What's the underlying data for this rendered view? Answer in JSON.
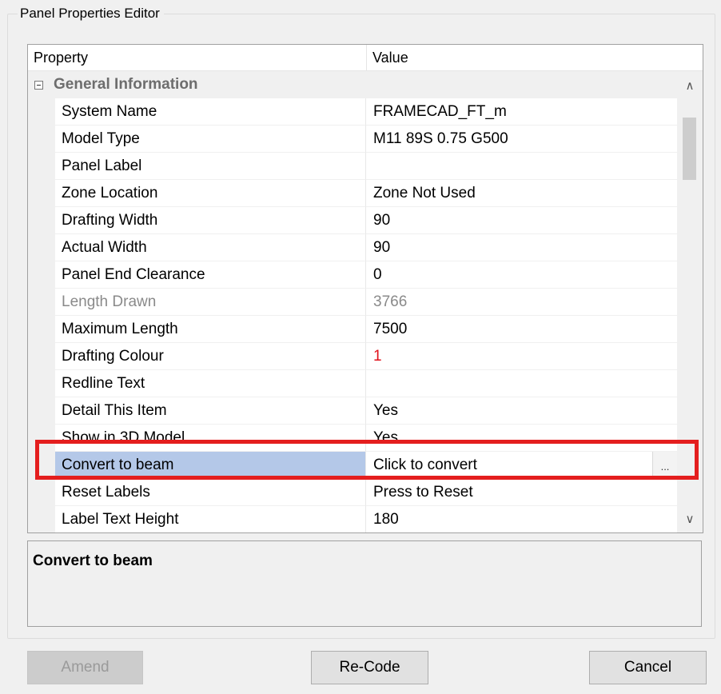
{
  "dialog": {
    "title": "Panel Properties Editor"
  },
  "grid": {
    "columns": {
      "property": "Property",
      "value": "Value"
    },
    "category": "General Information",
    "rows": [
      {
        "property": "System Name",
        "value": "FRAMECAD_FT_m"
      },
      {
        "property": "Model Type",
        "value": "M11 89S 0.75 G500"
      },
      {
        "property": "Panel Label",
        "value": ""
      },
      {
        "property": "Zone Location",
        "value": "Zone Not Used"
      },
      {
        "property": "Drafting Width",
        "value": "90"
      },
      {
        "property": "Actual Width",
        "value": "90"
      },
      {
        "property": "Panel End Clearance",
        "value": "0"
      },
      {
        "property": "Length Drawn",
        "value": "3766"
      },
      {
        "property": "Maximum Length",
        "value": "7500"
      },
      {
        "property": "Drafting Colour",
        "value": "1"
      },
      {
        "property": "Redline Text",
        "value": ""
      },
      {
        "property": "Detail This Item",
        "value": "Yes"
      },
      {
        "property": "Show in 3D Model",
        "value": "Yes"
      },
      {
        "property": "Convert to beam",
        "value": "Click to convert"
      },
      {
        "property": "Reset Labels",
        "value": "Press to Reset"
      },
      {
        "property": "Label Text Height",
        "value": "180"
      }
    ],
    "ellipsis": "...",
    "drafting_colour_color": "#e0101a",
    "selected_row_color": "#b4c8e8"
  },
  "description": {
    "title": "Convert to beam"
  },
  "buttons": {
    "amend": "Amend",
    "recode": "Re-Code",
    "cancel": "Cancel"
  },
  "highlight_color": "#e41e1e"
}
